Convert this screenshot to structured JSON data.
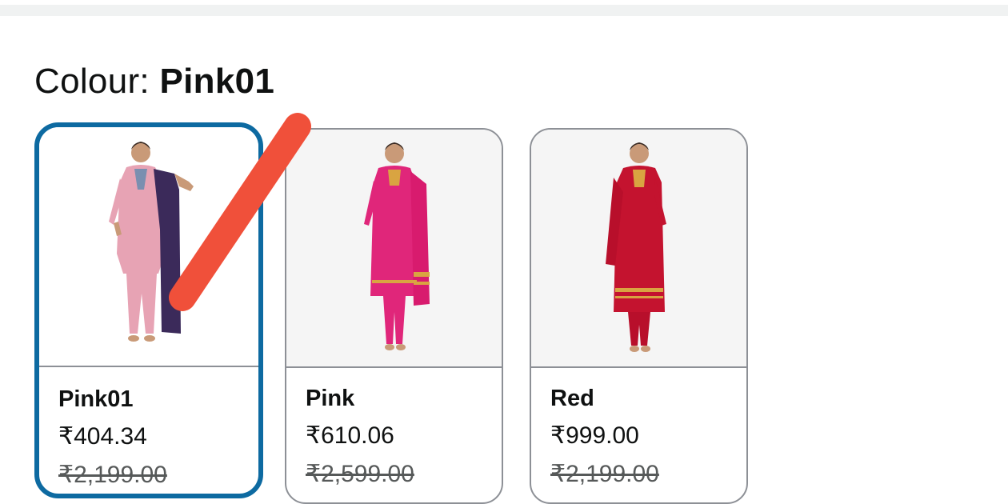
{
  "heading": {
    "prefix": "Colour: ",
    "value": "Pink01"
  },
  "swatches": [
    {
      "label": "Pink01",
      "price": "₹404.34",
      "mrp": "₹2,199.00",
      "selected": true,
      "outfit_color": "#e7a3b4",
      "dupatta_color": "#3b2a5a"
    },
    {
      "label": "Pink",
      "price": "₹610.06",
      "mrp": "₹2,599.00",
      "selected": false,
      "outfit_color": "#e0267a",
      "dupatta_color": "#d81b6e"
    },
    {
      "label": "Red",
      "price": "₹999.00",
      "mrp": "₹2,199.00",
      "selected": false,
      "outfit_color": "#c4132f",
      "dupatta_color": "#b80f2b"
    }
  ],
  "colors": {
    "selected_border": "#0d6aa1",
    "card_border": "#8d9096",
    "annotation_stroke": "#f0503a"
  }
}
